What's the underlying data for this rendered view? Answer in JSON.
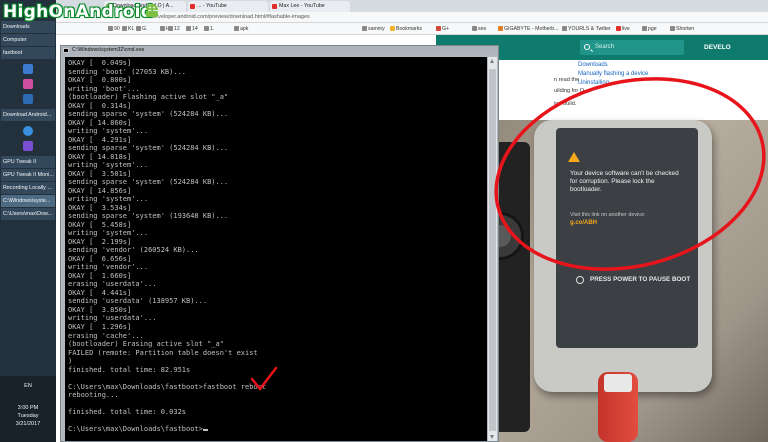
{
  "watermark": {
    "text": "HighOnAndroid"
  },
  "taskbar": {
    "items": [
      "Downloads",
      "Computer",
      "fastboot"
    ],
    "mid_items": [
      "Download Android...",
      "GPU Tweak II",
      "GPU Tweak II Moni...",
      "Recording Locally ...",
      "C:\\Windows\\syste...",
      "C:\\Users\\max\\Dow..."
    ],
    "lang": "EN",
    "time": "3:00 PM",
    "day": "Tuesday",
    "date": "3/21/2017"
  },
  "browser": {
    "tabs": [
      "Download Android O | A...",
      "... - YouTube",
      "Max Lee - YouTube"
    ],
    "url": "developer.android.com/preview/download.html#flashable-images",
    "bookmarks": [
      "90",
      "KL",
      "G.",
      "H",
      "12",
      "14",
      "1.",
      "apk",
      "sammy",
      "Bookmarks",
      "G+",
      "ses",
      "GIGABYTE - Motherb...",
      "YOURLS & Twitter",
      "live",
      "pge",
      "Shorten"
    ]
  },
  "page": {
    "search_placeholder": "Search",
    "header_right": "DEVELO",
    "toc": [
      "Downloads",
      "Manually flashing a device",
      "Uninstalling"
    ],
    "fragments": [
      "n read the",
      "uilding for O.",
      "ine build."
    ],
    "blue_fragment": "a h"
  },
  "phone": {
    "warning": "Your device software can't be checked for corruption. Please lock the bootloader.",
    "visit": "Visit this link on another device:",
    "code": "g.co/ABH",
    "power": "PRESS POWER TO PAUSE BOOT"
  },
  "cmd": {
    "title": "C:\\Windows\\system32\\cmd.exe",
    "lines": [
      "OKAY [  0.049s]",
      "sending 'boot' (27053 KB)...",
      "OKAY [  0.800s]",
      "writing 'boot'...",
      "(bootloader) Flashing active slot \"_a\"",
      "OKAY [  0.314s]",
      "sending sparse 'system' (524284 KB)...",
      "OKAY [ 14.860s]",
      "writing 'system'...",
      "OKAY [  4.291s]",
      "sending sparse 'system' (524284 KB)...",
      "OKAY [ 14.818s]",
      "writing 'system'...",
      "OKAY [  3.501s]",
      "sending sparse 'system' (524284 KB)...",
      "OKAY [ 14.856s]",
      "writing 'system'...",
      "OKAY [  3.534s]",
      "sending sparse 'system' (193648 KB)...",
      "OKAY [  5.458s]",
      "writing 'system'...",
      "OKAY [  2.199s]",
      "sending 'vendor' (260524 KB)...",
      "OKAY [  6.656s]",
      "writing 'vendor'...",
      "OKAY [  1.660s]",
      "erasing 'userdata'...",
      "OKAY [  4.441s]",
      "sending 'userdata' (138957 KB)...",
      "OKAY [  3.850s]",
      "writing 'userdata'...",
      "OKAY [  1.296s]",
      "erasing 'cache'...",
      "(bootloader) Erasing active slot \"_a\"",
      "FAILED (remote: Partition table doesn't exist",
      ")",
      "finished. total time: 82.951s",
      "",
      "C:\\Users\\max\\Downloads\\fastboot>fastboot reboot",
      "rebooting...",
      "",
      "finished. total time: 0.032s",
      "",
      "C:\\Users\\max\\Downloads\\fastboot>"
    ]
  },
  "colors": {
    "annotation_red": "#e8141b",
    "console_text": "#c0c0c0",
    "page_header": "#0f7a6e"
  }
}
